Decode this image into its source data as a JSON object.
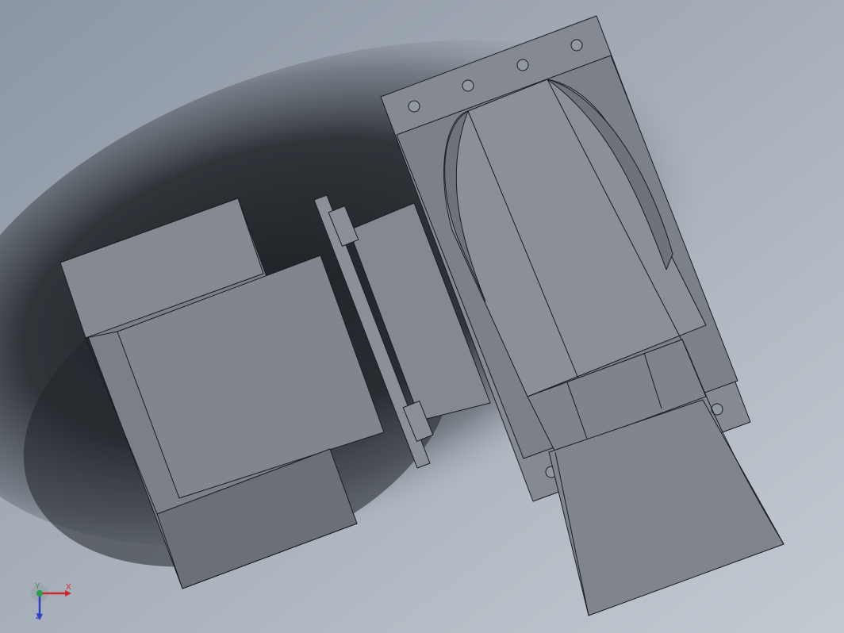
{
  "viewport": {
    "background_light": "#b9c1cb",
    "background_mid": "#8e98a4",
    "shadow_color": "#2b2e33"
  },
  "model": {
    "part_fill": "#7c818a",
    "part_fill_light": "#8c919a",
    "part_fill_dark": "#61656d",
    "edge_color": "#1a1c20"
  },
  "triad": {
    "x_label": "X",
    "y_label": "Y",
    "z_label": "Z",
    "x_color": "#d0282c",
    "y_color": "#2aa04a",
    "z_color": "#2a3fc8"
  }
}
